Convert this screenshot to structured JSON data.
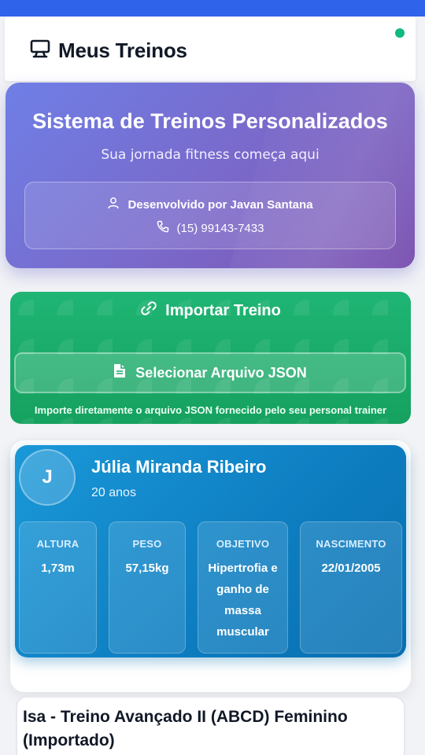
{
  "header": {
    "title": "Meus Treinos",
    "icon": "chat-monitor-icon",
    "status_color": "#10b981"
  },
  "hero": {
    "title": "Sistema de Treinos Personalizados",
    "subtitle": "Sua jornada fitness começa aqui",
    "developer": "Desenvolvido por Javan Santana",
    "phone": "(15) 99143-7433",
    "colors": {
      "start": "#6f7fe6",
      "end": "#7b52b0"
    }
  },
  "import": {
    "title": "Importar Treino",
    "button_label": "Selecionar Arquivo JSON",
    "hint": "Importe diretamente o arquivo JSON fornecido pelo seu personal trainer",
    "color": "#1fb574"
  },
  "profile": {
    "initial": "J",
    "name": "Júlia Miranda Ribeiro",
    "age": "20 anos",
    "stats": [
      {
        "label": "ALTURA",
        "value": "1,73m"
      },
      {
        "label": "PESO",
        "value": "57,15kg"
      },
      {
        "label": "OBJETIVO",
        "value": "Hipertrofia e ganho de massa muscular"
      },
      {
        "label": "NASCIMENTO",
        "value": "22/01/2005"
      }
    ],
    "color": "#1a98d8"
  },
  "workout": {
    "title": "Isa - Treino Avançado II (ABCD) Feminino (Importado)"
  }
}
